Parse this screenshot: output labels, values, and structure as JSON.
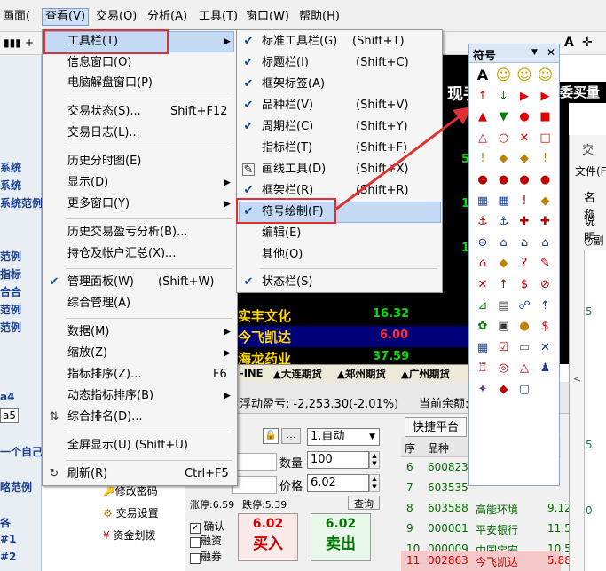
{
  "menubar": [
    "画面(",
    {
      "label": "查看(V)"
    },
    {
      "label": "交易(O)"
    },
    {
      "label": "分析(A)"
    },
    {
      "label": "工具(T)"
    },
    {
      "label": "窗口(W)"
    },
    {
      "label": "帮助(H)"
    }
  ],
  "menubar_labels": {
    "m0": "画面(",
    "m1": "查看(V)",
    "m2": "交易(O)",
    "m3": "分析(A)",
    "m4": "工具(T)",
    "m5": "窗口(W)",
    "m6": "帮助(H)"
  },
  "left_items": [
    "系统",
    "系统",
    "系统范例",
    "范例",
    "指标",
    "合合",
    "范例",
    "范例",
    "a4",
    "a5",
    "一个自己的",
    "略范例",
    "各",
    "#1",
    "#2"
  ],
  "view_menu": {
    "toolbar": "工具栏(T)",
    "info_window": "信息窗口(O)",
    "computer_window": "电脑解盘窗口(P)",
    "trade_status": "交易状态(S)...",
    "trade_status_sc": "Shift+F12",
    "trade_log": "交易日志(L)...",
    "history_time": "历史分时图(E)",
    "display": "显示(D)",
    "more_windows": "更多窗口(Y)",
    "history_pnl": "历史交易盈亏分析(B)...",
    "position_summary": "持仓及帐户汇总(X)...",
    "manage_panel": "管理面板(W)",
    "manage_panel_sc": "(Shift+W)",
    "integrated_mgmt": "综合管理(A)",
    "data": "数据(M)",
    "zoom": "缩放(Z)",
    "indicator_sort": "指标排序(Z)...",
    "indicator_sort_sc": "F6",
    "dynamic_sort": "动态指标排序(B)",
    "combined_rank": "综合排名(D)...",
    "fullscreen": "全屏显示(U) (Shift+U)",
    "refresh": "刷新(R)",
    "refresh_sc": "Ctrl+F5"
  },
  "toolbar_menu": {
    "std": "标准工具栏(G)",
    "std_sc": "(Shift+T)",
    "title": "标题栏(I)",
    "title_sc": "(Shift+C)",
    "frame_tag": "框架标签(A)",
    "variety": "品种栏(V)",
    "variety_sc": "(Shift+V)",
    "period": "周期栏(C)",
    "period_sc": "(Shift+Y)",
    "indicator": "指标栏(T)",
    "indicator_sc": "(Shift+F)",
    "draw": "画线工具(D)",
    "draw_sc": "(Shift+X)",
    "frame": "框架栏(R)",
    "frame_sc": "(Shift+R)",
    "symbol": "符号绘制(F)",
    "edit": "编辑(E)",
    "other": "其他(O)",
    "status": "状态栏(S)"
  },
  "symbol_window": {
    "title": "符号",
    "dropdown": "▼",
    "close": "✕"
  },
  "symbols": [
    "A",
    "☺",
    "☺",
    "☺",
    "↑",
    "↓",
    "▶",
    "▶",
    "▲",
    "▼",
    "●",
    "■",
    "△",
    "○",
    "✕",
    "□",
    "!",
    "◆",
    "◆",
    "!",
    "●",
    "●",
    "●",
    "●",
    "▦",
    "▦",
    "!",
    "◆",
    "⚓",
    "⚓",
    "✚",
    "✚",
    "⊖",
    "⌂",
    "⌂",
    "⌂",
    "⌂",
    "◆",
    "?",
    "✎",
    "✕",
    "↑",
    "$",
    "⊘",
    "⊿",
    "▤",
    "☍",
    "⇡",
    "✿",
    "▣",
    "●",
    "$",
    "▦",
    "☑",
    "▭",
    "✕",
    "♖",
    "◎",
    "△",
    "♟",
    "✦",
    "◆",
    "▢"
  ],
  "quote": {
    "header_cur": "现手",
    "header_bid": "委买量",
    "rows": [
      {
        "name": "实丰文化",
        "price": "16.32",
        "color": "#00e000"
      },
      {
        "name": "今飞凯达",
        "price": "6.00",
        "color": "#ff3030"
      },
      {
        "name": "海龙药业",
        "price": "37.59",
        "color": "#00e000"
      }
    ],
    "col_vals": [
      "5",
      "1",
      "1",
      "1"
    ],
    "tabs": [
      "-INE",
      "▲大连期货",
      "▲郑州期货",
      "▲广州期货",
      "▲"
    ]
  },
  "trade": {
    "float_pnl": "浮动盈亏: -2,253.30(-2.01%)",
    "balance": "当前余额: 1,",
    "dots": "...",
    "mode": "1.自动",
    "qty_label": "数量",
    "qty": "100",
    "price_label": "价格",
    "price": "6.02",
    "query": "查询",
    "limit_up": "涨停:6.59",
    "limit_down": "跌停:5.39",
    "confirm": "确认",
    "financing": "融资",
    "securities_loan": "融券",
    "buy_price": "6.02",
    "buy": "买入",
    "sell_price": "6.02",
    "sell": "卖出",
    "modify_pwd": "修改密码",
    "trade_settings": "交易设置",
    "fund_transfer": "资金划拨",
    "fast_platform": "快捷平台",
    "table_headers": [
      "序",
      "品种"
    ],
    "table_rows": [
      {
        "no": "6",
        "code": "600823",
        "name": "",
        "val": "",
        "color": "#006b00"
      },
      {
        "no": "7",
        "code": "603535",
        "name": "",
        "val": "",
        "color": "#006b00"
      },
      {
        "no": "8",
        "code": "603588",
        "name": "高能环境",
        "val": "9.12",
        "color": "#006b00"
      },
      {
        "no": "9",
        "code": "000001",
        "name": "平安银行",
        "val": "11.5",
        "color": "#006b00"
      },
      {
        "no": "10",
        "code": "000009",
        "name": "中国宝安",
        "val": "10.5",
        "color": "#006b00"
      },
      {
        "no": "11",
        "code": "002863",
        "name": "今飞凯达",
        "val": "5.88",
        "color": "#d00000"
      }
    ]
  },
  "right_window": {
    "title": "交",
    "file": "文件(F",
    "name": "名称",
    "desc": "说明",
    "radio": "副",
    "nums": [
      "5",
      "5",
      "0",
      "0"
    ]
  },
  "colors": {
    "accent": "#e03030",
    "highlight": "#c4daf4",
    "menu_bg": "#f5f5f5",
    "quote_bg": "#000000"
  }
}
